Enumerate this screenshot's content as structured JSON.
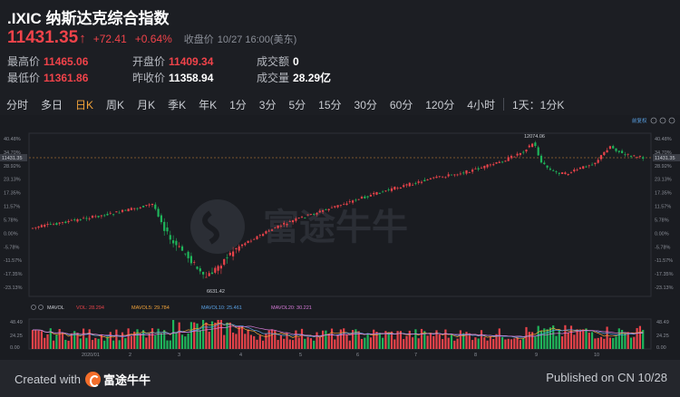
{
  "header": {
    "title": ".IXIC 纳斯达克综合指数",
    "price": "11431.35",
    "change": "+72.41",
    "change_pct": "+0.64%",
    "close_label": "收盘价",
    "close_time": "10/27 16:00(美东)"
  },
  "stats": {
    "high_label": "最高价",
    "high": "11465.06",
    "low_label": "最低价",
    "low": "11361.86",
    "open_label": "开盘价",
    "open": "11409.34",
    "prev_label": "昨收价",
    "prev": "11358.94",
    "amount_label": "成交额",
    "amount": "0",
    "volume_label": "成交量",
    "volume": "28.29亿"
  },
  "tabs": [
    {
      "label": "分时"
    },
    {
      "label": "多日"
    },
    {
      "label": "日K",
      "active": true
    },
    {
      "label": "周K"
    },
    {
      "label": "月K"
    },
    {
      "label": "季K"
    },
    {
      "label": "年K"
    },
    {
      "label": "1分"
    },
    {
      "label": "3分"
    },
    {
      "label": "5分"
    },
    {
      "label": "15分"
    },
    {
      "label": "30分"
    },
    {
      "label": "60分"
    },
    {
      "label": "120分"
    },
    {
      "label": "4小时"
    },
    {
      "label": "1天：1分K"
    }
  ],
  "chart": {
    "adjust_label": "前复权",
    "watermark": "富途牛牛",
    "current_price_tag": "11431.35",
    "max_label": "12074.06",
    "min_label": "6631.42",
    "pct_ticks": [
      "40.48%",
      "34.70%",
      "28.92%",
      "23.13%",
      "17.35%",
      "11.57%",
      "5.78%",
      "0.00%",
      "-5.78%",
      "-11.57%",
      "-17.35%",
      "-23.13%"
    ],
    "volume": {
      "label": "MAVOL",
      "vol": "VOL: 28.294",
      "ma5": "MAVOL5: 29.784",
      "ma10": "MAVOL10: 25.461",
      "ma20": "MAVOL20: 30.221",
      "ticks": [
        "48.49",
        "24.25",
        "0.00"
      ]
    },
    "x_labels": [
      "2020/01",
      "2",
      "3",
      "4",
      "5",
      "6",
      "7",
      "8",
      "9",
      "10"
    ],
    "colors": {
      "up": "#e8434a",
      "down": "#1fb55b",
      "ref_line": "#d88a3a",
      "ma5": "#f2a33a",
      "ma10": "#5aa2e6",
      "ma20": "#d77bd9"
    }
  },
  "chart_data": {
    "type": "line",
    "title": ".IXIC 纳斯达克综合指数 日K",
    "x": [
      "2020/01",
      "2",
      "3",
      "4",
      "5",
      "6",
      "7",
      "8",
      "9",
      "10"
    ],
    "series": [
      {
        "name": "",
        "values": [
          9000,
          9650,
          7750,
          8700,
          9400,
          10000,
          10700,
          11400,
          11100,
          11431.35
        ]
      }
    ],
    "annotations": {
      "high": 12074.06,
      "low": 6631.42
    },
    "ylabel": "",
    "ylim": [
      6631.42,
      12074.06
    ]
  },
  "footer": {
    "created": "Created with",
    "brand": "富途牛牛",
    "published": "Published on CN 10/28"
  }
}
